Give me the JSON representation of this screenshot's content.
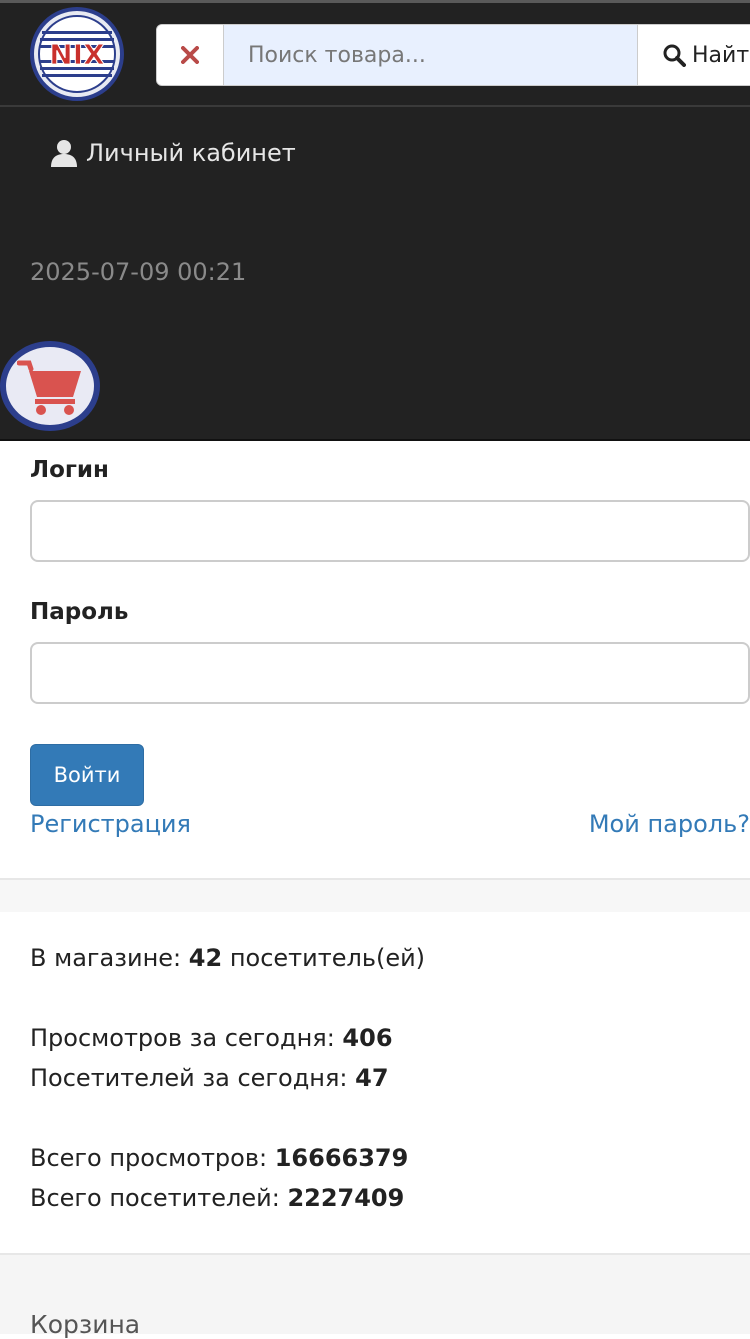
{
  "header": {
    "search": {
      "placeholder": "Поиск товара...",
      "value": "",
      "find_label": "Найти"
    },
    "account_label": "Личный кабинет",
    "datetime": "2025-07-09 00:21",
    "logo_text": "NIX"
  },
  "login_form": {
    "login_label": "Логин",
    "login_value": "",
    "password_label": "Пароль",
    "password_value": "",
    "submit_label": "Войти",
    "register_link": "Регистрация",
    "forgot_link": "Мой пароль?"
  },
  "stats": {
    "in_store_prefix": "В магазине:",
    "in_store_count": "42",
    "in_store_suffix": "посетитель(ей)",
    "views_today_label": "Просмотров за сегодня:",
    "views_today": "406",
    "visitors_today_label": "Посетителей за сегодня:",
    "visitors_today": "47",
    "views_total_label": "Всего просмотров:",
    "views_total": "16666379",
    "visitors_total_label": "Всего посетителей:",
    "visitors_total": "2227409"
  },
  "cart": {
    "title": "Корзина"
  },
  "colors": {
    "header_bg": "#222222",
    "link": "#337ab7",
    "button": "#337ab7",
    "clear_icon": "#b94a48",
    "cart_icon": "#d9534f"
  }
}
